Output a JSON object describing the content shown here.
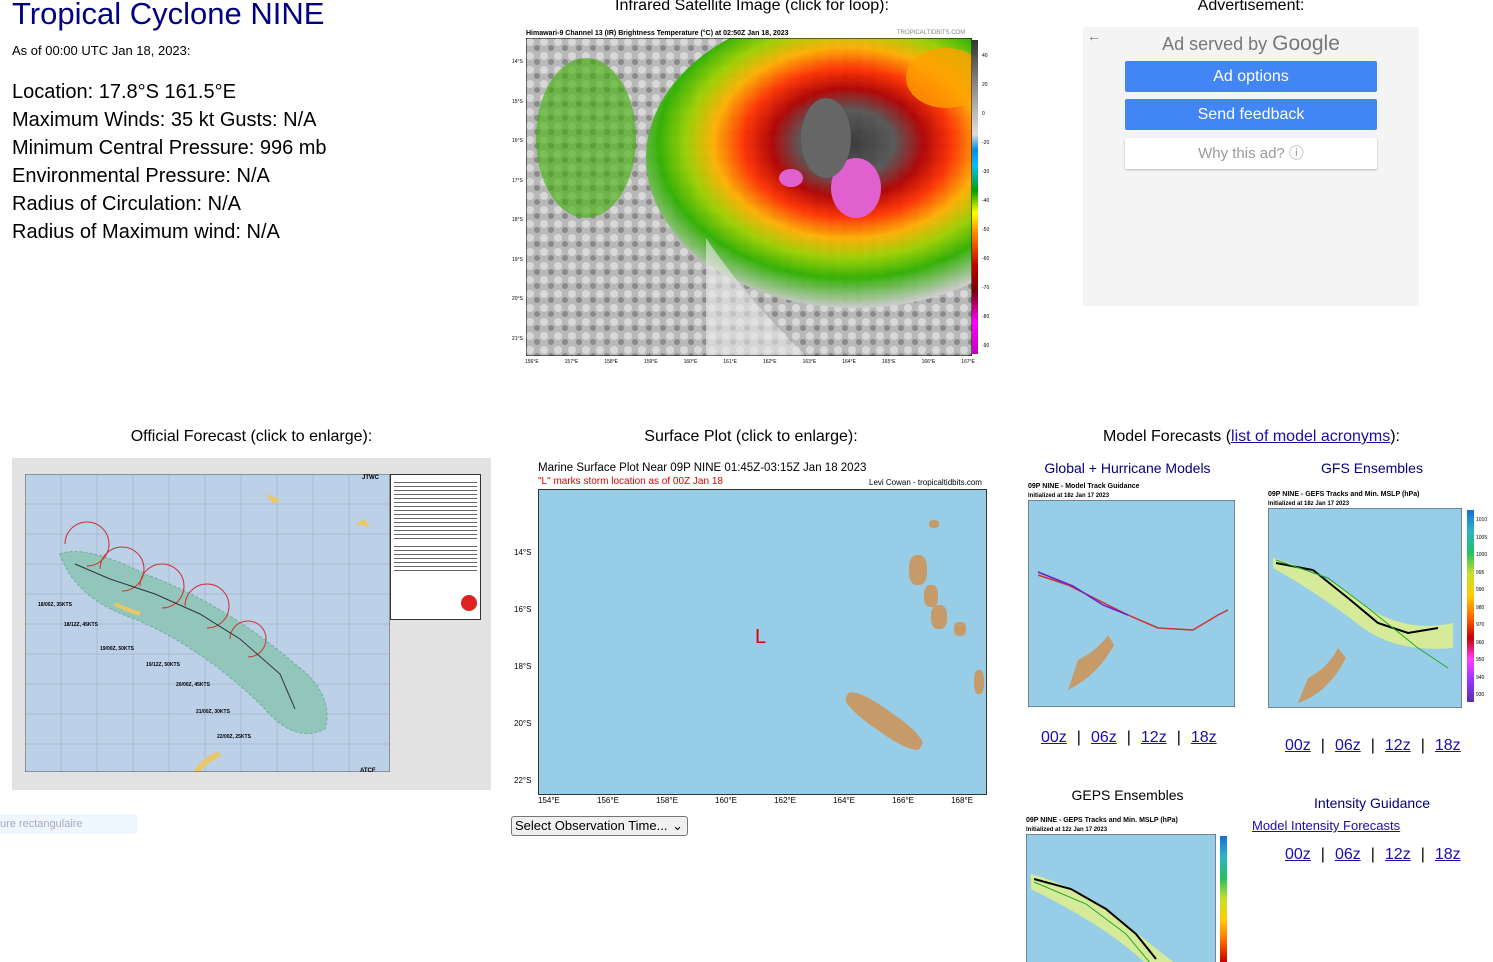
{
  "storm": {
    "title": "Tropical Cyclone NINE",
    "as_of": "As of 00:00 UTC Jan 18, 2023:",
    "location": "Location: 17.8°S 161.5°E",
    "winds": "Maximum Winds: 35 kt  Gusts: N/A",
    "pressure": "Minimum Central Pressure: 996 mb",
    "env_pressure": "Environmental Pressure: N/A",
    "roci": "Radius of Circulation: N/A",
    "rmw": "Radius of Maximum wind: N/A"
  },
  "satellite": {
    "header": "Infrared Satellite Image (click for loop):",
    "caption": "Himawari-9 Channel 13 (IR) Brightness Temperature (°C) at 02:50Z Jan 18, 2023",
    "credit": "TROPICALTIDBITS.COM",
    "lat_labels": [
      "14°S",
      "15°S",
      "16°S",
      "17°S",
      "18°S",
      "19°S",
      "20°S",
      "21°S"
    ],
    "lon_labels": [
      "156°E",
      "157°E",
      "158°E",
      "159°E",
      "160°E",
      "161°E",
      "162°E",
      "163°E",
      "164°E",
      "165°E",
      "166°E",
      "167°E"
    ],
    "scale_labels": [
      "40",
      "20",
      "0",
      "-20",
      "-30",
      "-40",
      "-50",
      "-60",
      "-70",
      "-80",
      "-90"
    ]
  },
  "ad": {
    "header": "Advertisement:",
    "served_by": "Ad served by",
    "google": "Google",
    "options": "Ad options",
    "feedback": "Send feedback",
    "why": "Why this ad? ⓘ",
    "back_icon": "←"
  },
  "official": {
    "header": "Official Forecast (click to enlarge):",
    "jtwc": "JTWC",
    "atcf": "ATCF",
    "points": [
      "18/00Z, 35KTS",
      "18/12Z, 45KTS",
      "19/00Z, 50KTS",
      "19/12Z, 50KTS",
      "20/00Z, 45KTS",
      "21/00Z, 30KTS",
      "22/00Z, 25KTS"
    ]
  },
  "rect_label": "ure rectangulaire",
  "surface": {
    "header": "Surface Plot (click to enlarge):",
    "title": "Marine Surface Plot Near 09P NINE 01:45Z-03:15Z Jan 18 2023",
    "subtitle": "\"L\" marks storm location as of 00Z Jan 18",
    "credit": "Levi Cowan - tropicaltidbits.com",
    "storm_mark": "L",
    "lat_labels": [
      "14°S",
      "16°S",
      "18°S",
      "20°S",
      "22°S"
    ],
    "lon_labels": [
      "154°E",
      "156°E",
      "158°E",
      "160°E",
      "162°E",
      "164°E",
      "166°E",
      "168°E"
    ],
    "select": "Select Observation Time..."
  },
  "models": {
    "header_prefix": "Model Forecasts (",
    "header_link": "list of model acronyms",
    "header_suffix": "):",
    "global_title": "Global + Hurricane Models",
    "global_img_title": "09P NINE - Model Track Guidance",
    "global_img_sub": "Initialized at 18z Jan 17 2023",
    "gfs_title": "GFS Ensembles",
    "gfs_img_title": "09P NINE - GEFS Tracks and Min. MSLP (hPa)",
    "gfs_img_sub": "Initialized at 18z Jan 17 2023",
    "geps_title": "GEPS Ensembles",
    "geps_img_title": "09P NINE - GEPS Tracks and Min. MSLP (hPa)",
    "geps_img_sub": "Initialized at 12z Jan 17 2023",
    "intensity_title": "Intensity Guidance",
    "intensity_link": "Model Intensity Forecasts",
    "runs": [
      "00z",
      "06z",
      "12z",
      "18z"
    ],
    "gfs_scale": [
      "1010",
      "1005",
      "1000",
      "995",
      "990",
      "980",
      "970",
      "960",
      "950",
      "940",
      "930"
    ]
  }
}
